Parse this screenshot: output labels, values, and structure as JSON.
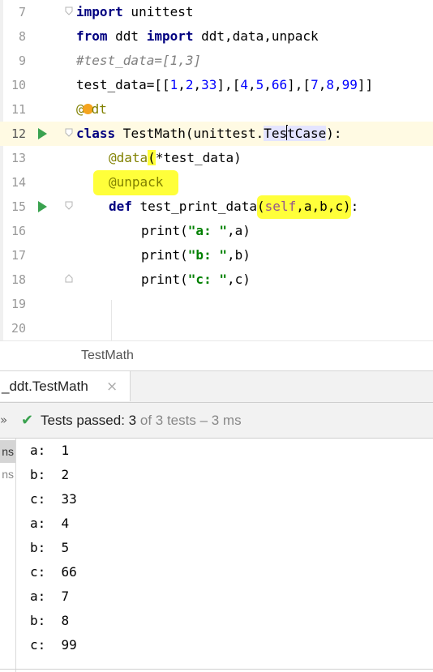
{
  "editor": {
    "line_numbers": [
      "7",
      "8",
      "9",
      "10",
      "11",
      "12",
      "13",
      "14",
      "15",
      "16",
      "17",
      "18",
      "19",
      "20"
    ],
    "l7": {
      "kw": "import",
      "rest": " unittest"
    },
    "l8": {
      "kw1": "from",
      "mid": " ddt ",
      "kw2": "import",
      "rest": " ddt,data,unpack"
    },
    "l9": {
      "comment": "#test_data=[1,3]"
    },
    "l10": {
      "name": "test_data=[[",
      "n1": "1",
      "c1": ",",
      "n2": "2",
      "c2": ",",
      "n3": "33",
      "c3": "],[",
      "n4": "4",
      "c4": ",",
      "n5": "5",
      "c5": ",",
      "n6": "66",
      "c6": "],[",
      "n7": "7",
      "c7": ",",
      "n8": "8",
      "c8": ",",
      "n9": "99",
      "c9": "]]"
    },
    "l11": {
      "a": "@",
      "b": "dt"
    },
    "l12": {
      "kw": "class",
      "a": " TestMath(unittest.",
      "sel": "Tes",
      "b": "tCase",
      "c": "):"
    },
    "l13": {
      "dec": "@data",
      "a": "(",
      "b": "*test_data)"
    },
    "l14": {
      "dec": "@unpack"
    },
    "l15": {
      "kw": "def",
      "a": " test_print_data",
      "p1": "(",
      "self": "self",
      "p2": ",a,b,c",
      "p3": ")",
      "p4": ":"
    },
    "l16": {
      "a": "print(",
      "s": "\"a: \"",
      "b": ",a)"
    },
    "l17": {
      "a": "print(",
      "s": "\"b: \"",
      "b": ",b)"
    },
    "l18": {
      "a": "print(",
      "s": "\"c: \"",
      "b": ",c)"
    }
  },
  "breadcrumb": {
    "label": "TestMath"
  },
  "run_tab": {
    "label": "_ddt.TestMath",
    "close": "×"
  },
  "status": {
    "expand": "»",
    "check": "✔",
    "passed_label": "Tests passed: ",
    "passed_count": "3",
    "rest": " of 3 tests – 3 ms"
  },
  "tree": {
    "row1": "ns",
    "row2": "ns"
  },
  "console": {
    "lines": [
      "a:  1",
      "b:  2",
      "c:  33",
      "a:  4",
      "b:  5",
      "c:  66",
      "a:  7",
      "b:  8",
      "c:  99"
    ]
  },
  "colors": {
    "keyword": "#000080",
    "decorator": "#808000",
    "string": "#008000",
    "number": "#0000ff",
    "highlight": "#ffff3a",
    "run_green": "#3aa24f"
  }
}
